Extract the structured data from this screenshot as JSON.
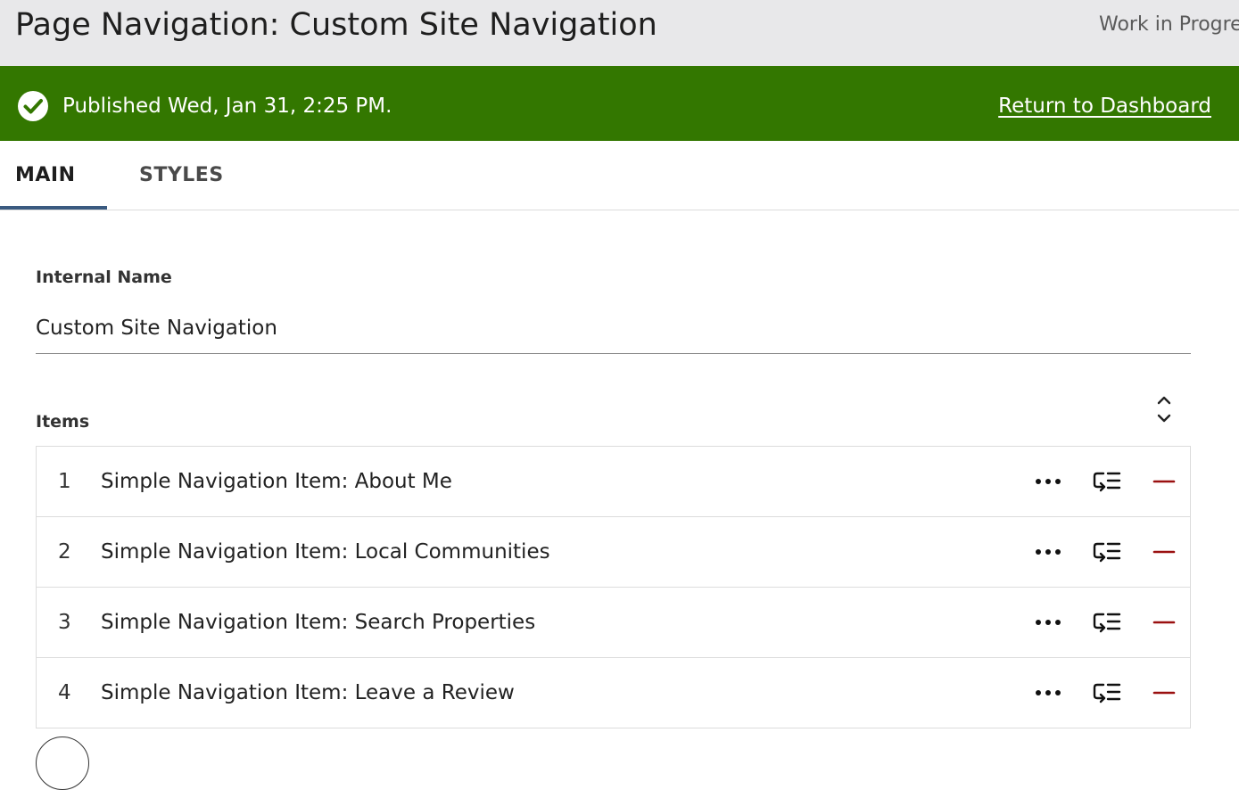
{
  "header": {
    "title": "Page Navigation: Custom Site Navigation",
    "status": "Work in Progress"
  },
  "banner": {
    "message": "Published Wed, Jan 31, 2:25 PM.",
    "link_label": "Return to Dashboard",
    "color": "#337700",
    "icon": "check-circle-icon"
  },
  "tabs": [
    {
      "label": "MAIN",
      "active": true
    },
    {
      "label": "STYLES",
      "active": false
    }
  ],
  "internal_name": {
    "label": "Internal Name",
    "value": "Custom Site Navigation"
  },
  "items": {
    "label": "Items",
    "list": [
      {
        "number": "1",
        "label": "Simple Navigation Item: About Me"
      },
      {
        "number": "2",
        "label": "Simple Navigation Item: Local Communities"
      },
      {
        "number": "3",
        "label": "Simple Navigation Item: Search Properties"
      },
      {
        "number": "4",
        "label": "Simple Navigation Item: Leave a Review"
      }
    ],
    "row_icons": [
      "more-options-icon",
      "reorder-list-icon",
      "remove-icon"
    ],
    "remove_color": "#9a1010"
  }
}
